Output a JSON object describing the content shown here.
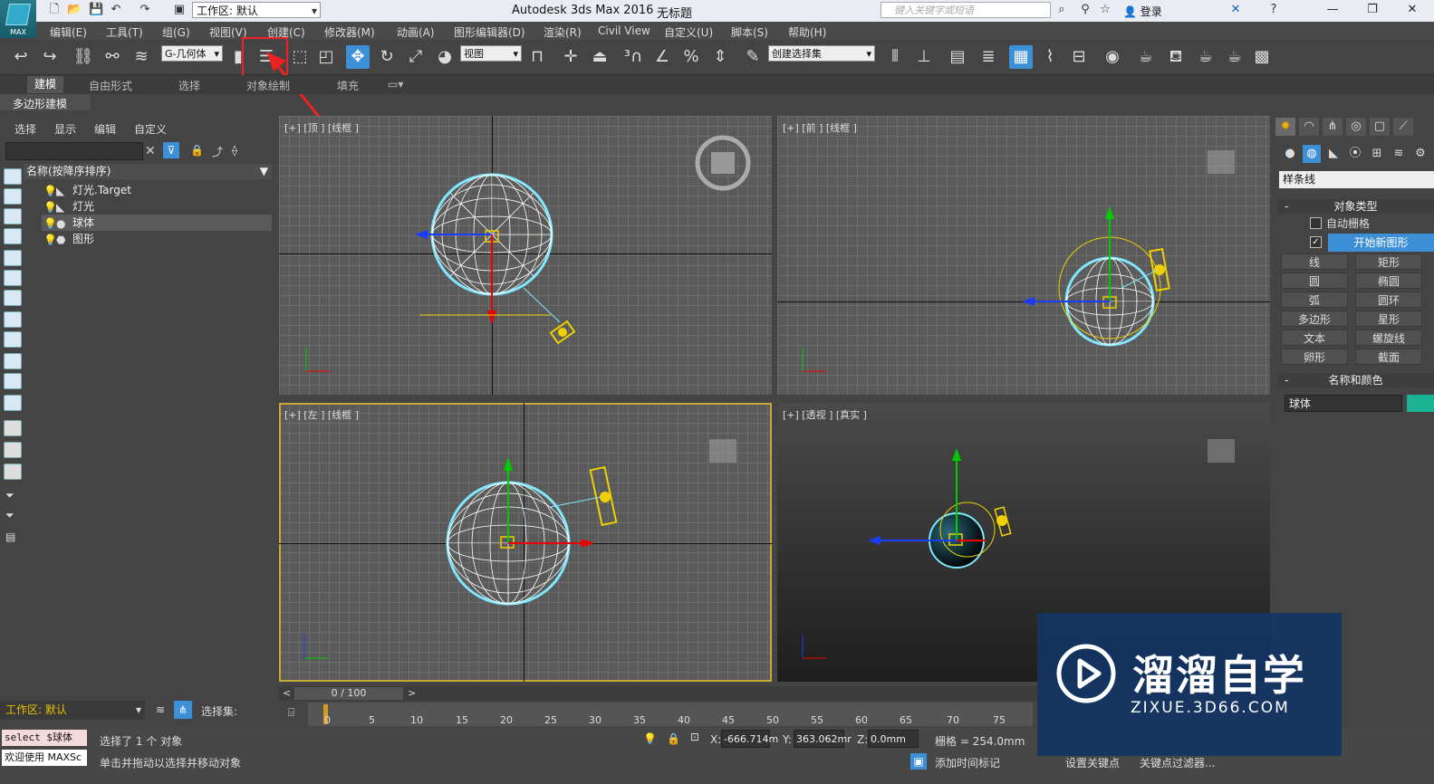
{
  "title_bar": {
    "workspace": "工作区: 默认",
    "app_title": "Autodesk 3ds Max 2016",
    "doc_title": "无标题",
    "search_placeholder": "键入关键字或短语",
    "login": "登录",
    "logo_text": "MAX"
  },
  "menu": [
    "编辑(E)",
    "工具(T)",
    "组(G)",
    "视图(V)",
    "创建(C)",
    "修改器(M)",
    "动画(A)",
    "图形编辑器(D)",
    "渲染(R)",
    "Civil View",
    "自定义(U)",
    "脚本(S)",
    "帮助(H)"
  ],
  "toolbar": {
    "selection_filter": "G-几何体",
    "ref_coord": "视图",
    "named_selection": "创建选择集"
  },
  "ribbon": {
    "tabs": [
      "建模",
      "自由形式",
      "选择",
      "对象绘制",
      "填充"
    ],
    "sub_label": "多边形建模"
  },
  "explorer": {
    "tabs": [
      "选择",
      "显示",
      "编辑",
      "自定义"
    ],
    "header": "名称(按降序排序)",
    "rows": [
      {
        "label": "灯光.Target",
        "selected": false
      },
      {
        "label": "灯光",
        "selected": false
      },
      {
        "label": "球体",
        "selected": true
      },
      {
        "label": "图形",
        "selected": false
      }
    ],
    "workspace_bottom": "工作区: 默认",
    "selection_set": "选择集:"
  },
  "viewports": {
    "top": "[+] [顶 ] [线框 ]",
    "front": "[+] [前 ] [线框 ]",
    "left": "[+] [左 ] [线框 ]",
    "perspective": "[+] [透视 ] [真实 ]"
  },
  "timeline": {
    "frame": "0 / 100",
    "ticks": [
      "0",
      "5",
      "10",
      "15",
      "20",
      "25",
      "30",
      "35",
      "40",
      "45",
      "50",
      "55",
      "60",
      "65",
      "70",
      "75"
    ]
  },
  "status": {
    "maxscript_line1": "select $球体",
    "maxscript_line2": "欢迎使用 MAXSc",
    "selection_status": "选择了 1 个 对象",
    "hint": "单击并拖动以选择并移动对象",
    "x_label": "X:",
    "x_value": "-666.714m",
    "y_label": "Y:",
    "y_value": "363.062mr",
    "z_label": "Z:",
    "z_value": "0.0mm",
    "grid": "栅格 = 254.0mm",
    "add_time_tag": "添加时间标记",
    "set_key": "设置关键点",
    "key_filters": "关键点过滤器..."
  },
  "command_panel": {
    "category": "样条线",
    "object_type_title": "对象类型",
    "auto_grid": "自动栅格",
    "start_new_shape": "开始新图形",
    "buttons": [
      "线",
      "矩形",
      "圆",
      "椭圆",
      "弧",
      "圆环",
      "多边形",
      "星形",
      "文本",
      "螺旋线",
      "卵形",
      "截面"
    ],
    "name_color_title": "名称和颜色",
    "object_name": "球体",
    "object_color": "#1ab394"
  },
  "watermark": {
    "cn": "溜溜自学",
    "url": "ZIXUE.3D66.COM"
  }
}
